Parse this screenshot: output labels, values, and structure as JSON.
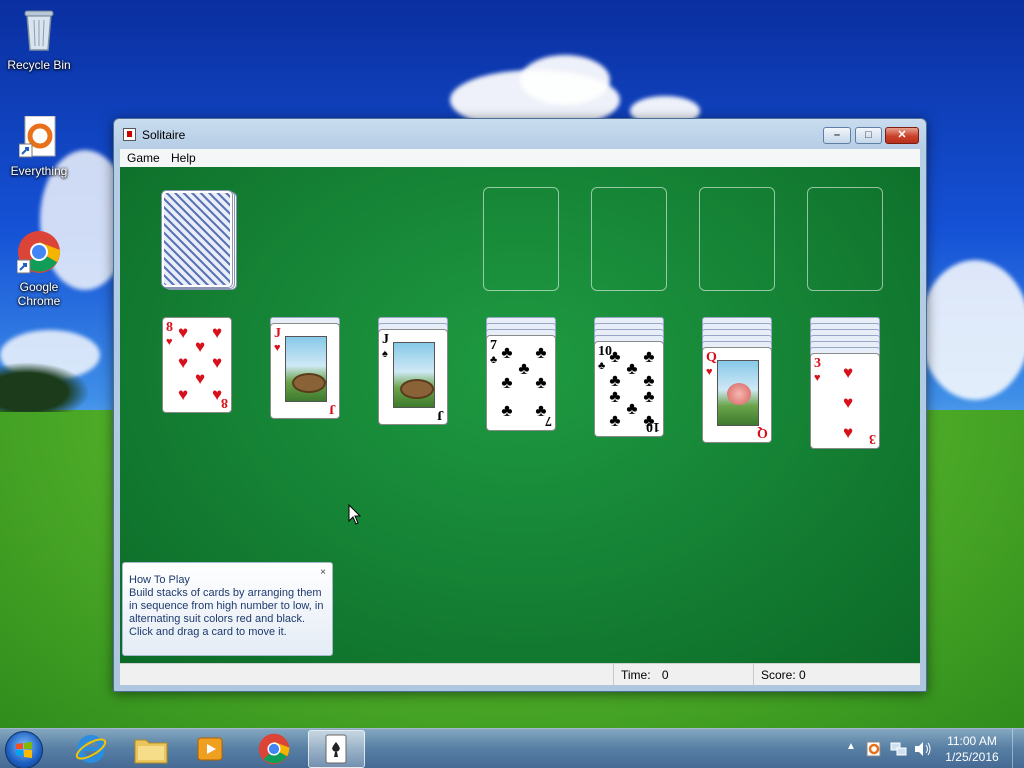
{
  "desktop": {
    "icons": [
      {
        "label": "Recycle Bin"
      },
      {
        "label": "Everything"
      },
      {
        "label": "Google\nChrome"
      }
    ]
  },
  "window": {
    "title": "Solitaire",
    "controls": {
      "minimize": "–",
      "maximize": "□",
      "close": "✕"
    },
    "menu": [
      "Game",
      "Help"
    ]
  },
  "game": {
    "stock": "card back",
    "foundations": 4,
    "tableau": [
      {
        "face_down": 0,
        "top": {
          "rank": "8",
          "suit": "♥"
        }
      },
      {
        "face_down": 1,
        "top": {
          "rank": "J",
          "suit": "♥"
        }
      },
      {
        "face_down": 2,
        "top": {
          "rank": "J",
          "suit": "♠"
        }
      },
      {
        "face_down": 3,
        "top": {
          "rank": "7",
          "suit": "♣"
        }
      },
      {
        "face_down": 4,
        "top": {
          "rank": "10",
          "suit": "♣"
        }
      },
      {
        "face_down": 5,
        "top": {
          "rank": "Q",
          "suit": "♥"
        }
      },
      {
        "face_down": 6,
        "top": {
          "rank": "3",
          "suit": "♥"
        }
      }
    ]
  },
  "howto": {
    "title": "How To Play",
    "body": "Build stacks of cards by arranging them in sequence from high number to low, in alternating suit colors red and black. Click and drag a card to move it.",
    "close": "×"
  },
  "status": {
    "time_label": "Time:",
    "time_value": "0",
    "score_label": "Score:",
    "score_value": "0"
  },
  "taskbar": {
    "apps": [
      "Internet Explorer",
      "File Explorer",
      "Media Player",
      "Google Chrome",
      "Solitaire"
    ],
    "active": "Solitaire",
    "clock_time": "11:00 AM",
    "clock_date": "1/25/2016"
  },
  "colors": {
    "felt": "#168536",
    "red_suit": "#d8101a",
    "black_suit": "#000000"
  }
}
